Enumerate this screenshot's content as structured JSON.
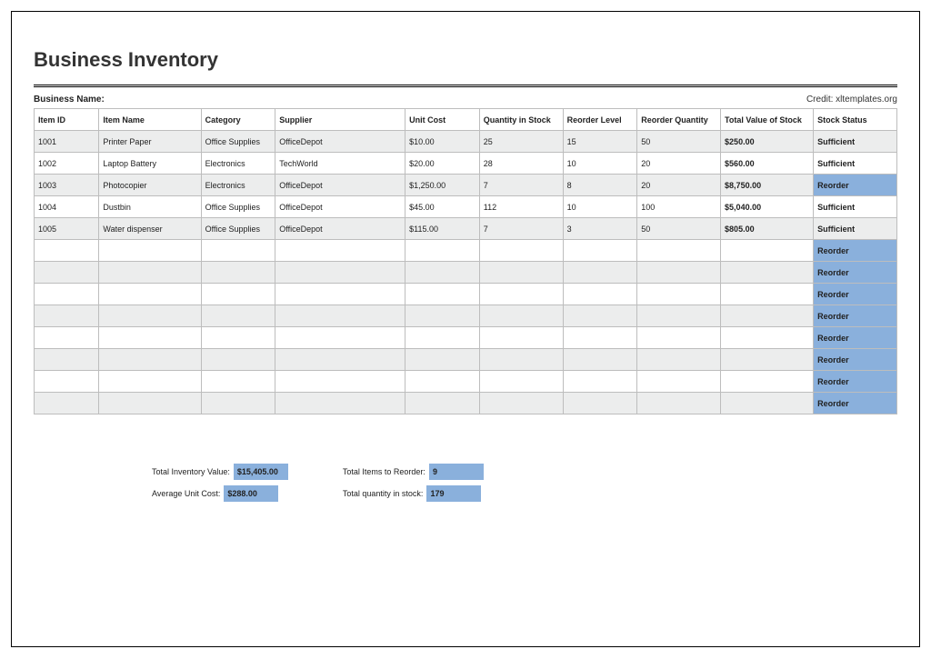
{
  "title": "Business Inventory",
  "business_name_label": "Business Name:",
  "credit": "Credit: xltemplates.org",
  "columns": [
    "Item ID",
    "Item Name",
    "Category",
    "Supplier",
    "Unit Cost",
    "Quantity in Stock",
    "Reorder Level",
    "Reorder Quantity",
    "Total Value of Stock",
    "Stock Status"
  ],
  "col_widths": [
    "70",
    "110",
    "80",
    "140",
    "80",
    "90",
    "80",
    "90",
    "100",
    "90"
  ],
  "rows": [
    {
      "id": "1001",
      "name": "Printer Paper",
      "cat": "Office Supplies",
      "sup": "OfficeDepot",
      "cost": "$10.00",
      "qty": "25",
      "reord": "15",
      "reqty": "50",
      "tot": "$250.00",
      "status": "Sufficient"
    },
    {
      "id": "1002",
      "name": "Laptop Battery",
      "cat": "Electronics",
      "sup": "TechWorld",
      "cost": "$20.00",
      "qty": "28",
      "reord": "10",
      "reqty": "20",
      "tot": "$560.00",
      "status": "Sufficient"
    },
    {
      "id": "1003",
      "name": "Photocopier",
      "cat": "Electronics",
      "sup": "OfficeDepot",
      "cost": "$1,250.00",
      "qty": "7",
      "reord": "8",
      "reqty": "20",
      "tot": "$8,750.00",
      "status": "Reorder"
    },
    {
      "id": "1004",
      "name": "Dustbin",
      "cat": "Office Supplies",
      "sup": "OfficeDepot",
      "cost": "$45.00",
      "qty": "112",
      "reord": "10",
      "reqty": "100",
      "tot": "$5,040.00",
      "status": "Sufficient"
    },
    {
      "id": "1005",
      "name": "Water dispenser",
      "cat": "Office Supplies",
      "sup": "OfficeDepot",
      "cost": "$115.00",
      "qty": "7",
      "reord": "3",
      "reqty": "50",
      "tot": "$805.00",
      "status": "Sufficient"
    },
    {
      "id": "",
      "name": "",
      "cat": "",
      "sup": "",
      "cost": "",
      "qty": "",
      "reord": "",
      "reqty": "",
      "tot": "",
      "status": "Reorder"
    },
    {
      "id": "",
      "name": "",
      "cat": "",
      "sup": "",
      "cost": "",
      "qty": "",
      "reord": "",
      "reqty": "",
      "tot": "",
      "status": "Reorder"
    },
    {
      "id": "",
      "name": "",
      "cat": "",
      "sup": "",
      "cost": "",
      "qty": "",
      "reord": "",
      "reqty": "",
      "tot": "",
      "status": "Reorder"
    },
    {
      "id": "",
      "name": "",
      "cat": "",
      "sup": "",
      "cost": "",
      "qty": "",
      "reord": "",
      "reqty": "",
      "tot": "",
      "status": "Reorder"
    },
    {
      "id": "",
      "name": "",
      "cat": "",
      "sup": "",
      "cost": "",
      "qty": "",
      "reord": "",
      "reqty": "",
      "tot": "",
      "status": "Reorder"
    },
    {
      "id": "",
      "name": "",
      "cat": "",
      "sup": "",
      "cost": "",
      "qty": "",
      "reord": "",
      "reqty": "",
      "tot": "",
      "status": "Reorder"
    },
    {
      "id": "",
      "name": "",
      "cat": "",
      "sup": "",
      "cost": "",
      "qty": "",
      "reord": "",
      "reqty": "",
      "tot": "",
      "status": "Reorder"
    },
    {
      "id": "",
      "name": "",
      "cat": "",
      "sup": "",
      "cost": "",
      "qty": "",
      "reord": "",
      "reqty": "",
      "tot": "",
      "status": "Reorder"
    }
  ],
  "summary": {
    "total_inventory_value": {
      "label": "Total Inventory Value:",
      "value": "$15,405.00"
    },
    "average_unit_cost": {
      "label": "Average Unit Cost:",
      "value": "$288.00"
    },
    "total_items_to_reorder": {
      "label": "Total Items to Reorder:",
      "value": "9"
    },
    "total_qty_in_stock": {
      "label": "Total quantity in stock:",
      "value": "179"
    }
  }
}
